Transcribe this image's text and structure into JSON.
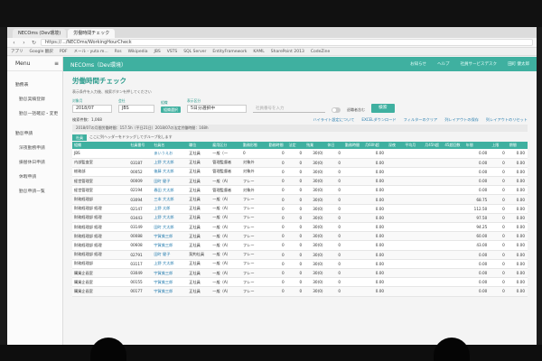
{
  "browser": {
    "tabs": [
      "NECOms (Dev環境)",
      "労働時間チェック"
    ],
    "url": "https://.../NECOms/WorkingHourCheck",
    "bookmarks": [
      "アプリ",
      "Google 翻訳",
      "PDF",
      "メール - yuta m...",
      "Rss",
      "Wikipedia",
      "JBS",
      "VSTS",
      "SQL Server",
      "EntityFramework",
      "KAML",
      "SharePoint 2013",
      "CodeZine"
    ]
  },
  "app": {
    "menu_label": "Menu",
    "brand": "NECOms（Dev環境）",
    "top_links": [
      "お知らせ",
      "ヘルプ",
      "社員サービスデスク",
      "田町 健太郎"
    ]
  },
  "sidebar": {
    "items": [
      {
        "label": "勤務表",
        "group": true
      },
      {
        "label": "勤怠実績登録",
        "group": false
      },
      {
        "label": "勤怠一括確認・変更",
        "group": false
      },
      {
        "label": "勤怠申請",
        "group": true
      },
      {
        "label": "深夜勤務申請",
        "group": false
      },
      {
        "label": "振替休日申請",
        "group": false
      },
      {
        "label": "休暇申請",
        "group": false
      },
      {
        "label": "勤怠申請一覧",
        "group": false
      }
    ]
  },
  "page": {
    "title": "労働時間チェック",
    "hint": "表示条件を入力後、検索ボタンを押してください",
    "filters": {
      "month_label": "対象月",
      "month_value": "2018/07",
      "dept_label": "会社",
      "dept_value": "JBS",
      "org_label": "組織",
      "org_pill": "組織選択",
      "period_label": "表示区分",
      "period_value": "5日分選択中",
      "search_placeholder": "社員番号を入力",
      "toggle_label": "退職者含む",
      "search_button": "検索"
    },
    "result_count": "検索件数：1,068",
    "links": [
      "ハイライト設定について",
      "EXCELダウンロード",
      "フィルターのクリア",
      "列レイアウトの保存",
      "列レイアウトのリセット"
    ],
    "summary": "2018/07の月間労働時間：157.5h（平日21日）2018/07の法定労働時間：168h",
    "drop_label": "ここに列ヘッダーをドラッグしてグループ化します",
    "drop_pill": "社員"
  },
  "table": {
    "headers": [
      "組織",
      "社員番号",
      "社員名",
      "職位",
      "雇用区分",
      "勤務形態",
      "勤務時間",
      "法定",
      "残業",
      "休日",
      "勤務時間",
      "月60h超",
      "深夜",
      "平均月",
      "月45h超",
      "45超回数",
      "年間",
      "上限",
      "期間"
    ],
    "rows": [
      [
        "JBS",
        "",
        "あいうえお",
        "正社員",
        "一般（一",
        "0",
        "0",
        "0",
        "30(0)",
        "0",
        "",
        "0.00",
        "",
        "",
        "",
        "",
        "0.00",
        "0",
        "0.00"
      ],
      [
        "内部監査室",
        "03187",
        "上野 大太郎",
        "正社員",
        "管理監督者",
        "対象外",
        "0",
        "0",
        "30(0)",
        "0",
        "",
        "0.00",
        "",
        "",
        "",
        "",
        "0.00",
        "0",
        "0.00"
      ],
      [
        "総務部",
        "00052",
        "後藤 大太郎",
        "正社員",
        "管理監督者",
        "対象外",
        "0",
        "0",
        "30(0)",
        "0",
        "",
        "0.00",
        "",
        "",
        "",
        "",
        "0.00",
        "0",
        "0.00"
      ],
      [
        "経営管理室",
        "00009",
        "田町 健子",
        "正社員",
        "一般（A）",
        "フレー",
        "0",
        "0",
        "30(0)",
        "0",
        "",
        "0.00",
        "",
        "",
        "",
        "",
        "0.00",
        "0",
        "0.00"
      ],
      [
        "経営管理室",
        "02194",
        "春田 大太郎",
        "正社員",
        "管理監督者",
        "対象外",
        "0",
        "0",
        "30(0)",
        "0",
        "",
        "0.00",
        "",
        "",
        "",
        "",
        "0.00",
        "0",
        "0.00"
      ],
      [
        "財務経理部",
        "03094",
        "三本 大太郎",
        "正社員",
        "一般（A）",
        "フレー",
        "0",
        "0",
        "30(0)",
        "0",
        "",
        "0.00",
        "",
        "",
        "",
        "",
        "68.75",
        "0",
        "0.00"
      ],
      [
        "財務経理部 経理",
        "02147",
        "上野 太郎",
        "正社員",
        "一般（A）",
        "フレー",
        "0",
        "0",
        "30(0)",
        "0",
        "",
        "0.00",
        "",
        "",
        "",
        "",
        "112.50",
        "0",
        "0.00"
      ],
      [
        "財務経理部 経理",
        "03443",
        "上野 大太郎",
        "正社員",
        "一般（A）",
        "フレー",
        "0",
        "0",
        "30(0)",
        "0",
        "",
        "0.00",
        "",
        "",
        "",
        "",
        "97.50",
        "0",
        "0.00"
      ],
      [
        "財務経理部 経理",
        "03149",
        "田町 大太郎",
        "正社員",
        "一般（A）",
        "フレー",
        "0",
        "0",
        "30(0)",
        "0",
        "",
        "0.00",
        "",
        "",
        "",
        "",
        "94.25",
        "0",
        "0.00"
      ],
      [
        "財務経理部 経理",
        "00088",
        "宇賀美三郎",
        "正社員",
        "一般（A）",
        "フレー",
        "0",
        "0",
        "30(0)",
        "0",
        "",
        "0.00",
        "",
        "",
        "",
        "",
        "60.00",
        "0",
        "0.00"
      ],
      [
        "財務経理部 経理",
        "00608",
        "宇賀美三郎",
        "正社員",
        "一般（A）",
        "フレー",
        "0",
        "0",
        "30(0)",
        "0",
        "",
        "0.00",
        "",
        "",
        "",
        "",
        "43.00",
        "0",
        "0.00"
      ],
      [
        "財務経理部 経理",
        "02791",
        "田町 健子",
        "契約社員",
        "一般（A）",
        "フレー",
        "0",
        "0",
        "30(0)",
        "0",
        "",
        "0.00",
        "",
        "",
        "",
        "",
        "0.00",
        "0",
        "0.00"
      ],
      [
        "財務経理部",
        "03117",
        "上野 大太郎",
        "正社員",
        "一般（A）",
        "フレー",
        "0",
        "0",
        "30(0)",
        "0",
        "",
        "0.00",
        "",
        "",
        "",
        "",
        "0.00",
        "0",
        "0.00"
      ],
      [
        "購買企画室",
        "03049",
        "宇賀美三郎",
        "正社員",
        "一般（A）",
        "フレー",
        "0",
        "0",
        "30(0)",
        "0",
        "",
        "0.00",
        "",
        "",
        "",
        "",
        "0.00",
        "0",
        "0.00"
      ],
      [
        "購買企画室",
        "00155",
        "宇賀美三郎",
        "正社員",
        "一般（A）",
        "フレー",
        "0",
        "0",
        "30(0)",
        "0",
        "",
        "0.00",
        "",
        "",
        "",
        "",
        "0.00",
        "0",
        "0.00"
      ],
      [
        "購買企画室",
        "00177",
        "宇賀美三郎",
        "正社員",
        "一般（A）",
        "フレー",
        "0",
        "0",
        "30(0)",
        "0",
        "",
        "0.00",
        "",
        "",
        "",
        "",
        "0.00",
        "0",
        "0.00"
      ]
    ]
  },
  "colors": {
    "accent": "#3fb0a0",
    "link": "#2a7fb0"
  }
}
